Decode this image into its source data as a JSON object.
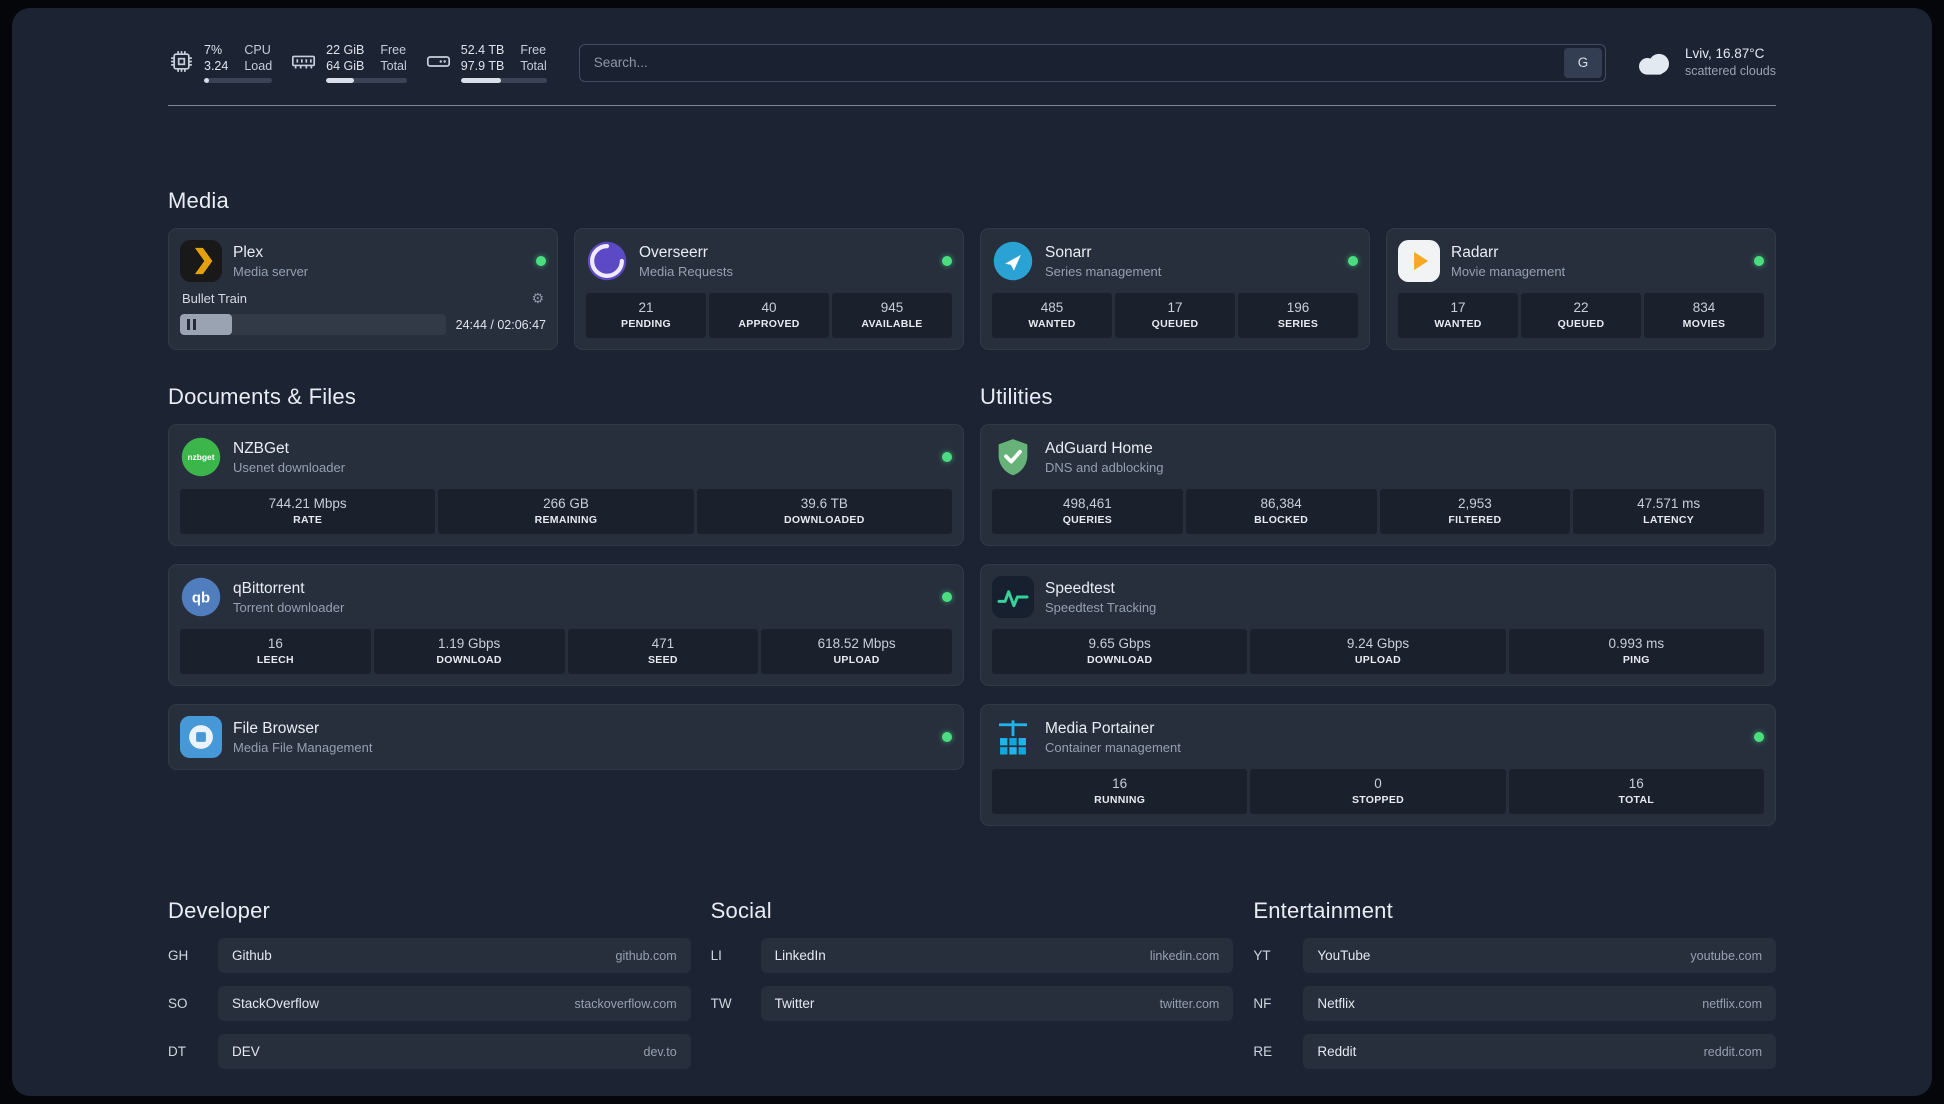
{
  "icons": {
    "gear": "⚙"
  },
  "colors": {
    "background": "#1c2433",
    "status_online": "#4ade80",
    "accent_light": "#d9dfe8"
  },
  "header": {
    "cpu": {
      "usage": "7%",
      "load": "3.24",
      "label_top": "CPU",
      "label_bottom": "Load",
      "bar_percent": 8
    },
    "memory": {
      "free": "22 GiB",
      "total": "64 GiB",
      "label_top": "Free",
      "label_bottom": "Total",
      "bar_percent": 34
    },
    "disk": {
      "free": "52.4 TB",
      "total": "97.9 TB",
      "label_top": "Free",
      "label_bottom": "Total",
      "bar_percent": 47
    },
    "search": {
      "placeholder": "Search...",
      "provider": "G"
    },
    "weather": {
      "location": "Lviv, 16.87°C",
      "condition": "scattered clouds"
    }
  },
  "sections": {
    "media": {
      "title": "Media"
    },
    "documents": {
      "title": "Documents & Files"
    },
    "utilities": {
      "title": "Utilities"
    }
  },
  "services": {
    "plex": {
      "name": "Plex",
      "description": "Media server",
      "status": "online",
      "player": {
        "track": "Bullet Train",
        "time": "24:44 / 02:06:47",
        "progress_percent": 19.5
      }
    },
    "overseerr": {
      "name": "Overseerr",
      "description": "Media Requests",
      "status": "online",
      "stats": [
        {
          "value": "21",
          "label": "PENDING"
        },
        {
          "value": "40",
          "label": "APPROVED"
        },
        {
          "value": "945",
          "label": "AVAILABLE"
        }
      ]
    },
    "sonarr": {
      "name": "Sonarr",
      "description": "Series management",
      "status": "online",
      "stats": [
        {
          "value": "485",
          "label": "WANTED"
        },
        {
          "value": "17",
          "label": "QUEUED"
        },
        {
          "value": "196",
          "label": "SERIES"
        }
      ]
    },
    "radarr": {
      "name": "Radarr",
      "description": "Movie management",
      "status": "online",
      "stats": [
        {
          "value": "17",
          "label": "WANTED"
        },
        {
          "value": "22",
          "label": "QUEUED"
        },
        {
          "value": "834",
          "label": "MOVIES"
        }
      ]
    },
    "nzbget": {
      "name": "NZBGet",
      "description": "Usenet downloader",
      "status": "online",
      "stats": [
        {
          "value": "744.21 Mbps",
          "label": "RATE"
        },
        {
          "value": "266 GB",
          "label": "REMAINING"
        },
        {
          "value": "39.6 TB",
          "label": "DOWNLOADED"
        }
      ]
    },
    "qbittorrent": {
      "name": "qBittorrent",
      "description": "Torrent downloader",
      "status": "online",
      "stats": [
        {
          "value": "16",
          "label": "LEECH"
        },
        {
          "value": "1.19 Gbps",
          "label": "DOWNLOAD"
        },
        {
          "value": "471",
          "label": "SEED"
        },
        {
          "value": "618.52 Mbps",
          "label": "UPLOAD"
        }
      ]
    },
    "filebrowser": {
      "name": "File Browser",
      "description": "Media File Management",
      "status": "online"
    },
    "adguard": {
      "name": "AdGuard Home",
      "description": "DNS and adblocking",
      "stats": [
        {
          "value": "498,461",
          "label": "QUERIES"
        },
        {
          "value": "86,384",
          "label": "BLOCKED"
        },
        {
          "value": "2,953",
          "label": "FILTERED"
        },
        {
          "value": "47.571 ms",
          "label": "LATENCY"
        }
      ]
    },
    "speedtest": {
      "name": "Speedtest",
      "description": "Speedtest Tracking",
      "stats": [
        {
          "value": "9.65 Gbps",
          "label": "DOWNLOAD"
        },
        {
          "value": "9.24 Gbps",
          "label": "UPLOAD"
        },
        {
          "value": "0.993 ms",
          "label": "PING"
        }
      ]
    },
    "portainer": {
      "name": "Media Portainer",
      "description": "Container management",
      "status": "online",
      "stats": [
        {
          "value": "16",
          "label": "RUNNING"
        },
        {
          "value": "0",
          "label": "STOPPED"
        },
        {
          "value": "16",
          "label": "TOTAL"
        }
      ]
    }
  },
  "bookmarks": {
    "developer": {
      "title": "Developer",
      "items": [
        {
          "abbr": "GH",
          "name": "Github",
          "url": "github.com"
        },
        {
          "abbr": "SO",
          "name": "StackOverflow",
          "url": "stackoverflow.com"
        },
        {
          "abbr": "DT",
          "name": "DEV",
          "url": "dev.to"
        }
      ]
    },
    "social": {
      "title": "Social",
      "items": [
        {
          "abbr": "LI",
          "name": "LinkedIn",
          "url": "linkedin.com"
        },
        {
          "abbr": "TW",
          "name": "Twitter",
          "url": "twitter.com"
        }
      ]
    },
    "entertainment": {
      "title": "Entertainment",
      "items": [
        {
          "abbr": "YT",
          "name": "YouTube",
          "url": "youtube.com"
        },
        {
          "abbr": "NF",
          "name": "Netflix",
          "url": "netflix.com"
        },
        {
          "abbr": "RE",
          "name": "Reddit",
          "url": "reddit.com"
        }
      ]
    }
  }
}
